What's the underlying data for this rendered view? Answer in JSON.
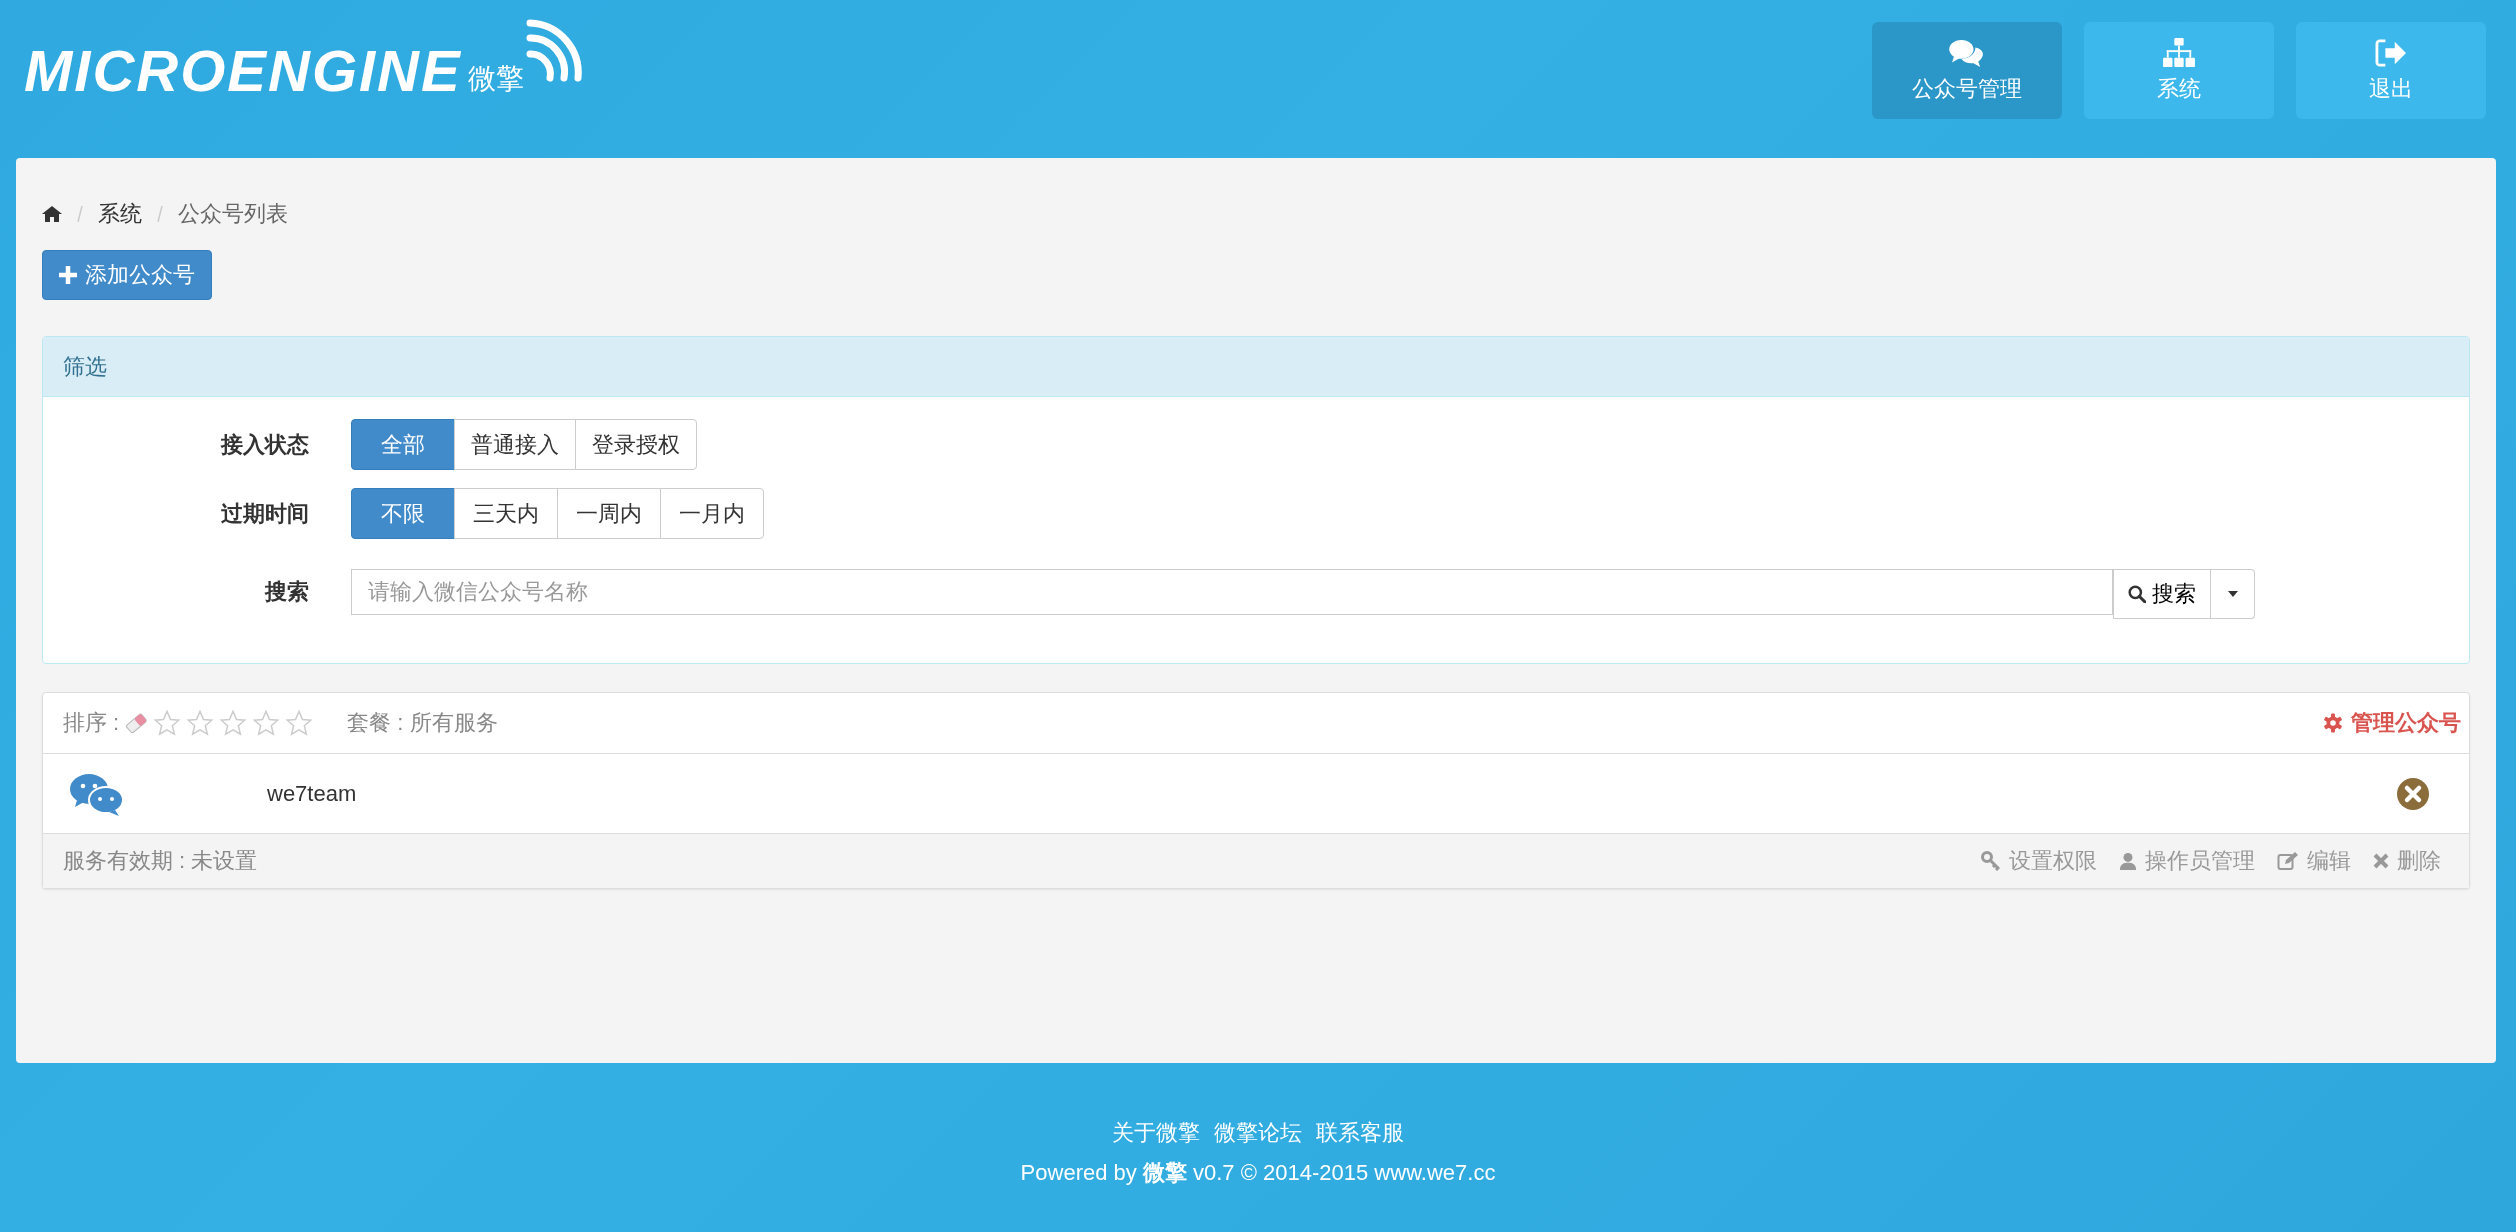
{
  "header": {
    "logo_text": "MICROENGINE",
    "logo_cn": "微擎",
    "nav": [
      {
        "label": "公众号管理",
        "selected": true
      },
      {
        "label": "系统",
        "selected": false
      },
      {
        "label": "退出",
        "selected": false
      }
    ]
  },
  "breadcrumb": [
    "系统",
    "公众号列表"
  ],
  "add_button": "添加公众号",
  "filter": {
    "title": "筛选",
    "groups": [
      {
        "label": "接入状态",
        "options": [
          {
            "label": "全部",
            "selected": true
          },
          {
            "label": "普通接入",
            "selected": false
          },
          {
            "label": "登录授权",
            "selected": false
          }
        ]
      },
      {
        "label": "过期时间",
        "options": [
          {
            "label": "不限",
            "selected": true
          },
          {
            "label": "三天内",
            "selected": false
          },
          {
            "label": "一周内",
            "selected": false
          },
          {
            "label": "一月内",
            "selected": false
          }
        ]
      }
    ],
    "search": {
      "label": "搜索",
      "placeholder": "请输入微信公众号名称",
      "button": "搜索"
    }
  },
  "accounts": [
    {
      "sort_label": "排序 :",
      "stars": 0,
      "plan": "套餐 : 所有服务",
      "manage": "管理公众号",
      "name": "we7team",
      "expiry": "服务有效期 : 未设置",
      "actions": [
        "设置权限",
        "操作员管理",
        "编辑",
        "删除"
      ]
    }
  ],
  "footer": {
    "links": [
      "关于微擎",
      "微擎论坛",
      "联系客服"
    ],
    "powered": "Powered by **微擎** v0.7 © 2014-2015 www.we7.cc"
  }
}
